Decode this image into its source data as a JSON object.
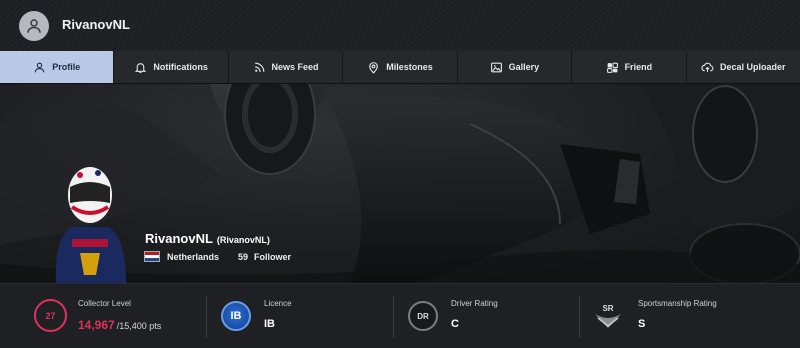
{
  "header": {
    "username": "RivanovNL",
    "avatar_icon": "user-avatar-icon"
  },
  "tabs": [
    {
      "label": "Profile",
      "icon": "user-icon",
      "active": true
    },
    {
      "label": "Notifications",
      "icon": "bell-icon",
      "active": false
    },
    {
      "label": "News Feed",
      "icon": "rss-icon",
      "active": false
    },
    {
      "label": "Milestones",
      "icon": "map-pin-icon",
      "active": false
    },
    {
      "label": "Gallery",
      "icon": "image-icon",
      "active": false
    },
    {
      "label": "Friend",
      "icon": "friends-icon",
      "active": false
    },
    {
      "label": "Decal Uploader",
      "icon": "cloud-upload-icon",
      "active": false
    }
  ],
  "profile": {
    "name": "RivanovNL",
    "handle": "(RivanovNL)",
    "country": "Netherlands",
    "follower_count": "59",
    "follower_label": "Follower"
  },
  "stats": {
    "collector": {
      "label": "Collector Level",
      "level": "27",
      "points": "14,967",
      "max": "/15,400 pts"
    },
    "licence": {
      "label": "Licence",
      "badge": "IB",
      "value": "IB"
    },
    "driver_rating": {
      "label": "Driver Rating",
      "badge": "DR",
      "value": "C"
    },
    "sportsmanship": {
      "label": "Sportsmanship Rating",
      "badge": "SR",
      "value": "S"
    }
  },
  "colors": {
    "accent": "#e1305c",
    "active_tab": "#b9c9e6",
    "licence_blue": "#2b6fd6"
  }
}
